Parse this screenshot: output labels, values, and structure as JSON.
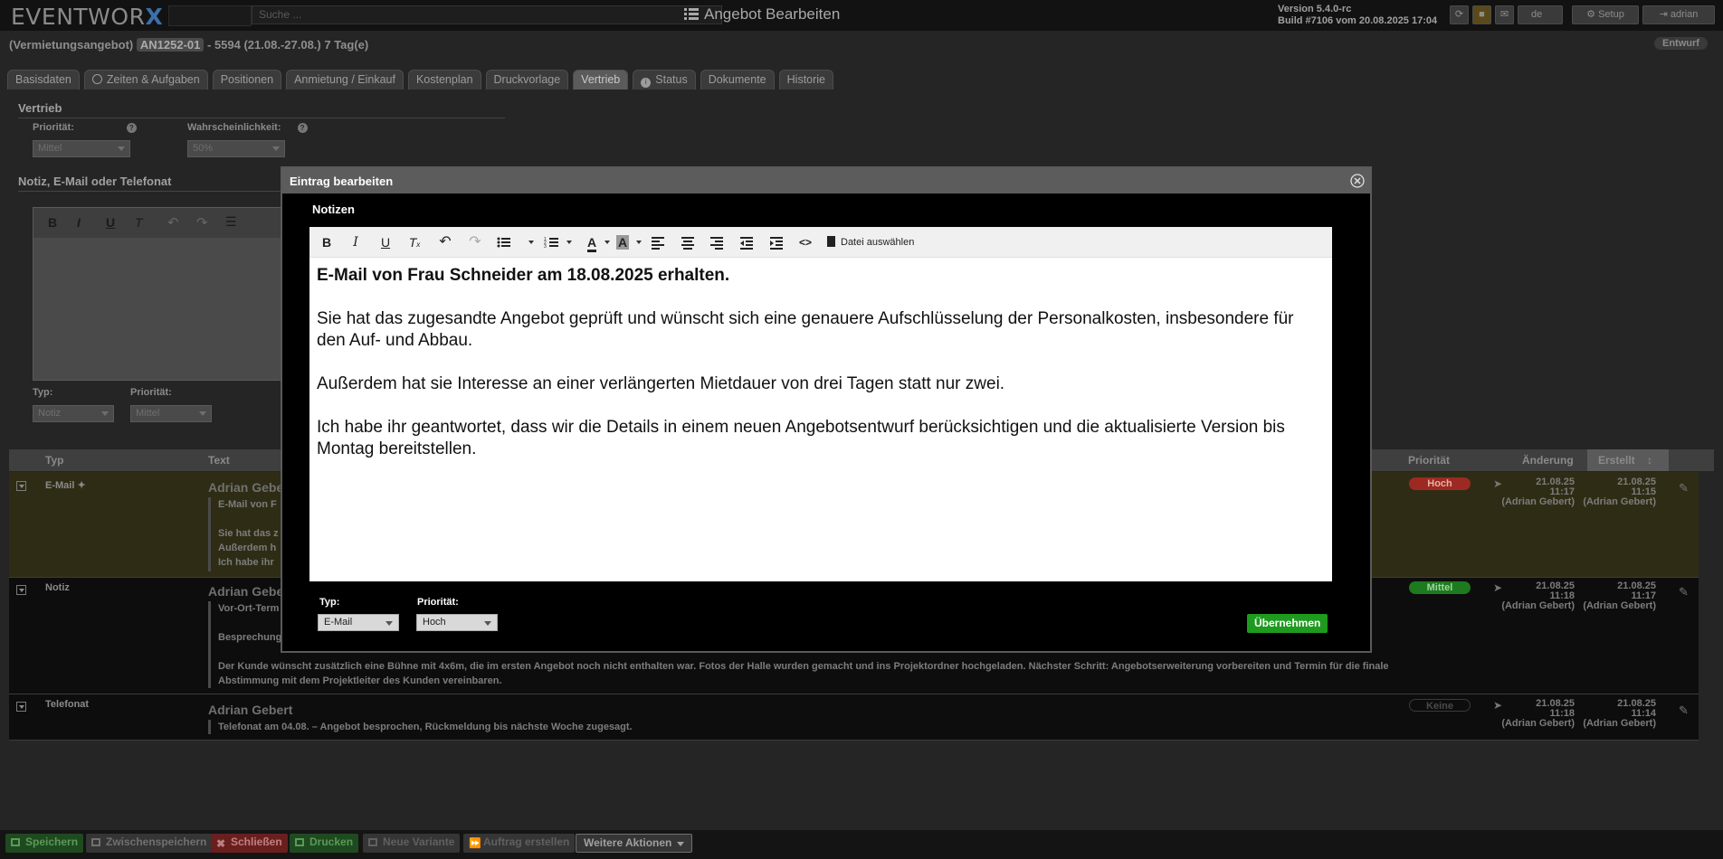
{
  "app": {
    "logo_text": "EVENTWOR",
    "logo_x": "X",
    "search_placeholder": "Suche ...",
    "page_heading": "Angebot Bearbeiten",
    "version_line1": "Version 5.4.0-rc",
    "version_line2": "Build #7106 vom 20.08.2025 17:04",
    "lang": "de",
    "setup_label": "Setup",
    "user_label": "adrian"
  },
  "header": {
    "type_label": "(Vermietungsangebot)",
    "code": "AN1252-01",
    "rest": "- 5594 (21.08.-27.08.) 7 Tag(e)",
    "status_badge": "Entwurf"
  },
  "tabs": [
    {
      "label": "Basisdaten",
      "active": false
    },
    {
      "label": "Zeiten & Aufgaben",
      "active": false
    },
    {
      "label": "Positionen",
      "active": false
    },
    {
      "label": "Anmietung / Einkauf",
      "active": false
    },
    {
      "label": "Kostenplan",
      "active": false
    },
    {
      "label": "Druckvorlage",
      "active": false
    },
    {
      "label": "Vertrieb",
      "active": true
    },
    {
      "label": "Status",
      "active": false
    },
    {
      "label": "Dokumente",
      "active": false
    },
    {
      "label": "Historie",
      "active": false
    }
  ],
  "vertrieb": {
    "heading": "Vertrieb",
    "prioritaet_label": "Priorität:",
    "prioritaet_value": "Mittel",
    "wahrscheinlichkeit_label": "Wahrscheinlichkeit:",
    "wahrscheinlichkeit_value": "50%",
    "notiz_heading": "Notiz, E-Mail oder Telefonat",
    "typ_label": "Typ:",
    "typ_value": "Notiz",
    "prio2_label": "Priorität:",
    "prio2_value": "Mittel"
  },
  "table": {
    "headers": {
      "typ": "Typ",
      "text": "Text",
      "prioritaet": "Priorität",
      "aenderung": "Änderung",
      "erstellt": "Erstellt"
    },
    "rows": [
      {
        "typ": "E-Mail",
        "author": "Adrian Gebe",
        "lines": [
          "E-Mail von F",
          "",
          "Sie hat das z",
          "Außerdem h",
          "Ich habe ihr"
        ],
        "priority": "Hoch",
        "changed_date": "21.08.25",
        "changed_time": "11:17",
        "changed_by": "(Adrian Gebert)",
        "created_date": "21.08.25",
        "created_time": "11:15",
        "created_by": "(Adrian Gebert)"
      },
      {
        "typ": "Notiz",
        "author": "Adrian Gebe",
        "lines": [
          "Vor-Ort-Term",
          "",
          "Besprechung",
          "",
          "Der Kunde wünscht zusätzlich eine Bühne mit 4x6m, die im ersten Angebot noch nicht enthalten war. Fotos der Halle wurden gemacht und ins Projektordner hochgeladen. Nächster Schritt: Angebotserweiterung vorbereiten und Termin für die finale",
          "Abstimmung mit dem Projektleiter des Kunden vereinbaren."
        ],
        "priority": "Mittel",
        "changed_date": "21.08.25",
        "changed_time": "11:18",
        "changed_by": "(Adrian Gebert)",
        "created_date": "21.08.25",
        "created_time": "11:17",
        "created_by": "(Adrian Gebert)"
      },
      {
        "typ": "Telefonat",
        "author": "Adrian Gebert",
        "lines": [
          "Telefonat am 04.08. – Angebot besprochen, Rückmeldung bis nächste Woche zugesagt."
        ],
        "priority": "Keine",
        "changed_date": "21.08.25",
        "changed_time": "11:18",
        "changed_by": "(Adrian Gebert)",
        "created_date": "21.08.25",
        "created_time": "11:14",
        "created_by": "(Adrian Gebert)"
      }
    ]
  },
  "footer": {
    "speichern": "Speichern",
    "zwischenspeichern": "Zwischenspeichern",
    "schliessen": "Schließen",
    "drucken": "Drucken",
    "neue_variante": "Neue Variante",
    "auftrag_erstellen": "Auftrag erstellen",
    "weitere_aktionen": "Weitere Aktionen"
  },
  "modal": {
    "title": "Eintrag bearbeiten",
    "section_label": "Notizen",
    "file_button": "Datei auswählen",
    "content": [
      "E-Mail von Frau Schneider am 18.08.2025 erhalten.",
      "Sie hat das zugesandte Angebot geprüft und wünscht sich eine genauere Aufschlüsselung der Personalkosten, insbesondere für den Auf- und Abbau.",
      "Außerdem hat sie Interesse an einer verlängerten Mietdauer von drei Tagen statt nur zwei.",
      "Ich habe ihr geantwortet, dass wir die Details in einem neuen Angebotsentwurf berücksichtigen und die aktualisierte Version bis Montag bereitstellen."
    ],
    "typ_label": "Typ:",
    "typ_value": "E-Mail",
    "prio_label": "Priorität:",
    "prio_value": "Hoch",
    "apply_button": "Übernehmen"
  },
  "colors": {
    "accent_green": "#1e9a1e",
    "badge_hoch": "#c0392b",
    "badge_mittel": "#1e9a1e",
    "highlight_row": "#2f2c15"
  },
  "icons": [
    "close-icon",
    "bold-icon",
    "italic-icon",
    "underline-icon",
    "clear-format-icon",
    "undo-icon",
    "redo-icon",
    "bullet-list-icon",
    "numbered-list-icon",
    "text-color-icon",
    "bg-color-icon",
    "align-left-icon",
    "align-center-icon",
    "align-right-icon",
    "outdent-icon",
    "indent-icon",
    "code-icon",
    "file-icon",
    "pin-icon",
    "edit-icon",
    "expand-icon"
  ]
}
